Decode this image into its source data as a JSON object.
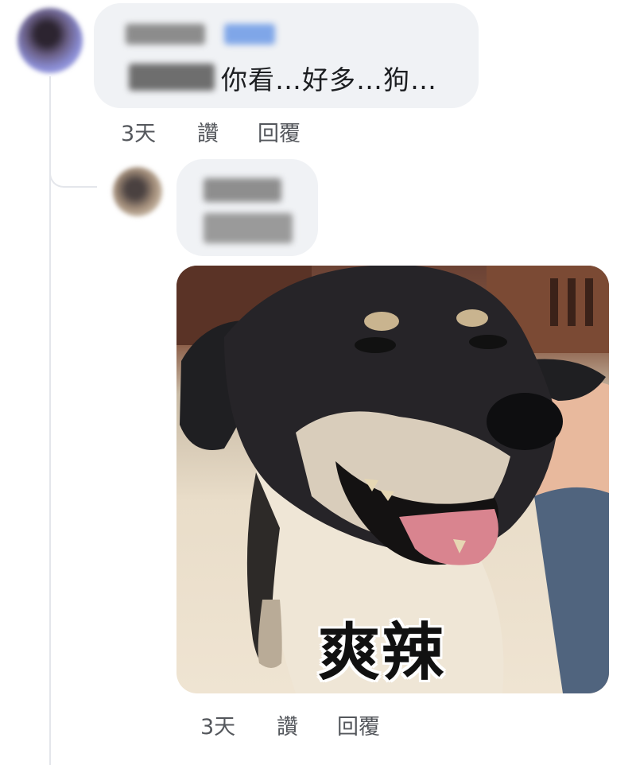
{
  "comments": [
    {
      "text": "你看…好多…狗…",
      "actions": {
        "time": "3天",
        "like": "讚",
        "reply": "回覆"
      }
    },
    {
      "sticker_caption": "爽辣",
      "actions": {
        "time": "3天",
        "like": "讚",
        "reply": "回覆"
      }
    }
  ],
  "icons": {
    "avatar_1": "user-avatar-blurred",
    "avatar_2": "user-avatar-blurred",
    "sticker": "dog-sticker-image"
  },
  "colors": {
    "bubble": "#f0f2f5",
    "text": "#1c1e21",
    "meta": "#54575c"
  }
}
